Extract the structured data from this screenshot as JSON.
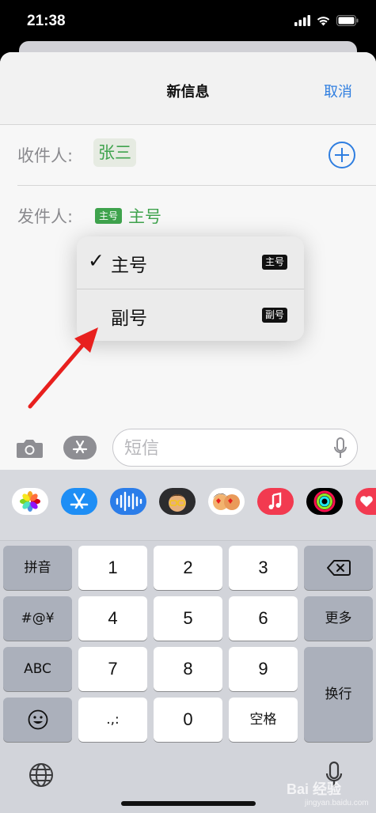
{
  "status_bar": {
    "time": "21:38"
  },
  "nav": {
    "title": "新信息",
    "cancel_label": "取消"
  },
  "to_field": {
    "label": "收件人:",
    "recipient": "张三"
  },
  "from_field": {
    "label": "发件人:",
    "badge": "主号",
    "value": "主号"
  },
  "sim_menu": {
    "items": [
      {
        "label": "主号",
        "badge": "主号",
        "checked": true,
        "check_glyph": "✓"
      },
      {
        "label": "副号",
        "badge": "副号",
        "checked": false
      }
    ]
  },
  "compose": {
    "placeholder": "短信"
  },
  "keyboard": {
    "keys": {
      "pinyin": "拼音",
      "symbols": "#@¥",
      "abc": "ABC",
      "k1": "1",
      "k2": "2",
      "k3": "3",
      "k4": "4",
      "k5": "5",
      "k6": "6",
      "k7": "7",
      "k8": "8",
      "k9": "9",
      "k0": "0",
      "punct": ".,:",
      "more": "更多",
      "space": "空格",
      "return": "换行"
    }
  },
  "watermark": {
    "brand": "Bai  经验",
    "sub": "jingyan.baidu.com"
  },
  "colors": {
    "accent_blue": "#2f7ee0",
    "sim_green": "#3fa34d",
    "arrow_red": "#e8201e"
  }
}
